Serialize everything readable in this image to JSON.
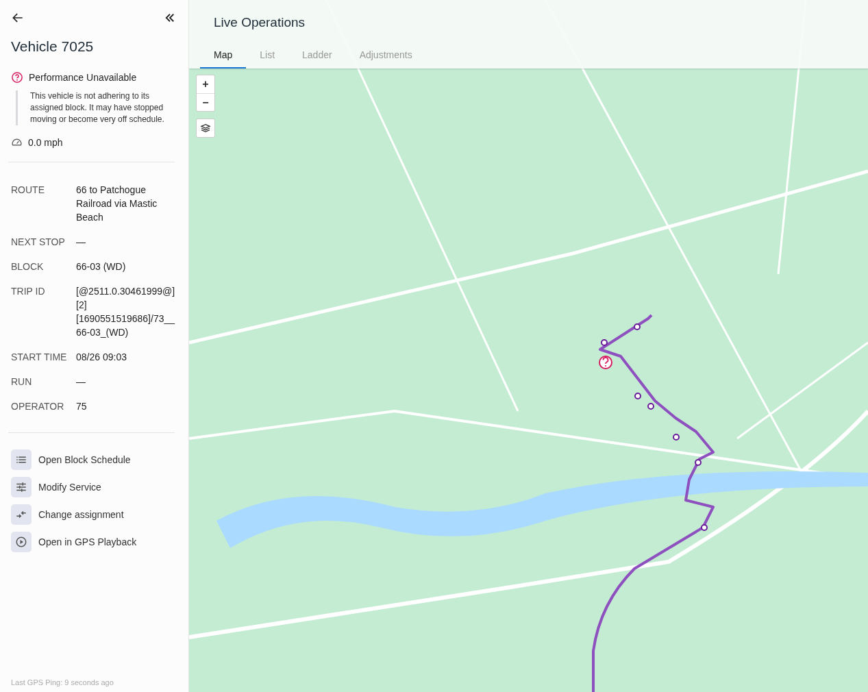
{
  "sidebar": {
    "title": "Vehicle 7025",
    "status": {
      "title": "Performance Unavailable",
      "description": "This vehicle is not adhering to its assigned block. It may have stopped moving or become very off schedule."
    },
    "speed": "0.0 mph",
    "details": [
      {
        "label": "ROUTE",
        "value": "66 to Patchogue Railroad via Mastic Beach"
      },
      {
        "label": "NEXT STOP",
        "value": "—"
      },
      {
        "label": "BLOCK",
        "value": "66-03 (WD)"
      },
      {
        "label": "TRIP ID",
        "value": "[@2511.0.30461999@][2][1690551519686]/73__66-03_(WD)"
      },
      {
        "label": "START TIME",
        "value": "08/26 09:03"
      },
      {
        "label": "RUN",
        "value": "—"
      },
      {
        "label": "OPERATOR",
        "value": "75"
      }
    ],
    "actions": [
      {
        "kind": "list",
        "label": "Open Block Schedule"
      },
      {
        "kind": "sliders",
        "label": "Modify Service"
      },
      {
        "kind": "swap",
        "label": "Change assignment"
      },
      {
        "kind": "play",
        "label": "Open in GPS Playback"
      }
    ],
    "footer": "Last GPS Ping: 9 seconds ago"
  },
  "main": {
    "title": "Live Operations",
    "tabs": [
      {
        "label": "Map",
        "selected": true
      },
      {
        "label": "List",
        "selected": false
      },
      {
        "label": "Ladder",
        "selected": false
      },
      {
        "label": "Adjustments",
        "selected": false
      }
    ],
    "map_controls": [
      {
        "kind": "zoom_in",
        "label": "+"
      },
      {
        "kind": "zoom_out",
        "label": "−"
      },
      {
        "kind": "layers"
      }
    ]
  }
}
